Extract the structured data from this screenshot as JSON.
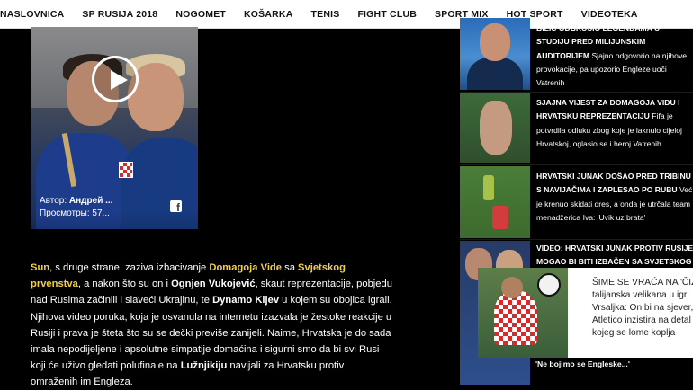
{
  "nav": {
    "items": [
      "NASLOVNICA",
      "SP RUSIJA 2018",
      "NOGOMET",
      "KOŠARKA",
      "TENIS",
      "FIGHT CLUB",
      "SPORT MIX",
      "HOT SPORT",
      "VIDEOTEKA"
    ]
  },
  "video": {
    "author_label": "Автор:",
    "author_name": "Андрей ...",
    "views_label": "Просмотры:",
    "views_value": "57...",
    "play_icon": "play-icon",
    "share_icon": "facebook-icon"
  },
  "article": {
    "p1": "Sun",
    "p2": ", s druge strane, zaziva izbacivanje ",
    "p3": "Domagoja Vide",
    "p4": " sa ",
    "p5": "Svjetskog prvenstva",
    "p6": ", a nakon što su on i ",
    "p7": "Ognjen Vukojević",
    "p8": ", skaut reprezentacije, pobjedu nad Rusima začinili i slaveći Ukrajinu, te ",
    "p9": "Dynamo Kijev",
    "p10": " u kojem su obojica igrali. Njihova video poruka, koja je osvanula na internetu izazvala je žestoke reakcije u Rusiji i prava je šteta što su se dečki previše zanijeli. Naime, Hrvatska je do sada imala nepodijeljene i apsolutne simpatije domaćina i sigurni smo da bi svi Rusi koji će uživo gledati polufinale na ",
    "p11": "Lužnjikiju",
    "p12": " navijali za Hrvatsku protiv omraženih im Engleza."
  },
  "sidebar": {
    "items": [
      {
        "title": "BILIĆ ODBRUSIO LEGENDAMA U STUDIJU PRED MILIJUNSKIM AUDITORIJEM",
        "sub": "Sjajno odgovorio na njihove provokacije, pa upozorio Engleze uoči Vatrenih"
      },
      {
        "title": "SJAJNA VIJEST ZA DOMAGOJA VIDU I HRVATSKU REPREZENTACIJU",
        "sub": "Fifa je potvrdila odluku zbog koje je laknulo cijeloj Hrvatskoj, oglasio se i heroj Vatrenih"
      },
      {
        "title": "HRVATSKI JUNAK DOŠAO PRED TRIBINU S NAVIJAČIMA I ZAPLESAO PO RUBU",
        "sub": "Već je krenuo skidati dres, a onda je utrčala team menadžerica Iva: 'Uvik uz brata'"
      },
      {
        "title": "VIDEO: HRVATSKI JUNAK PROTIV RUSIJE MOGAO BI BITI IZBAČEN SA SVJETSKOG",
        "sub": ""
      }
    ],
    "bottom_text": "'Ne bojimo se Engleske...'"
  },
  "popup": {
    "line1": "ŠIME SE VRAĆA NA 'ČIZM",
    "line2": "talijanska velikana u igri",
    "line3": "Vrsaljka: On bi na sjever,",
    "line4": "Atletico inzistira na detal",
    "line5": "kojeg se lome koplja"
  }
}
